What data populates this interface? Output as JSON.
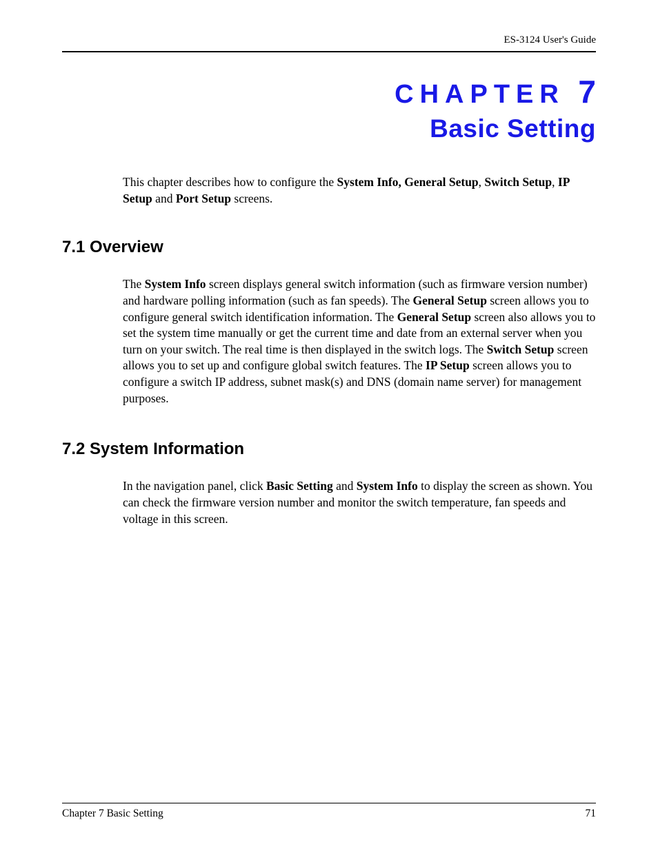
{
  "header": {
    "guide_title": "ES-3124 User's Guide"
  },
  "chapter": {
    "label_word": "CHAPTER",
    "number": "7",
    "title": "Basic Setting"
  },
  "intro": {
    "t1": "This chapter describes how to configure the ",
    "b1": "System Info, General Setup",
    "t2": ", ",
    "b2": "Switch Setup",
    "t3": ", ",
    "b3": "IP Setup",
    "t4": " and ",
    "b4": "Port Setup",
    "t5": " screens."
  },
  "section71": {
    "heading": "7.1  Overview",
    "p": {
      "t1": "The ",
      "b1": "System Info",
      "t2": " screen displays general switch information (such as firmware version number) and hardware polling information (such as fan speeds). The ",
      "b2": "General Setup",
      "t3": " screen allows you to configure general switch identification information. The ",
      "b3": "General Setup",
      "t4": " screen also allows you to set the system time manually or get the current time and date from an external server when you turn on your switch. The real time is then displayed in the switch logs. The ",
      "b4": "Switch Setup",
      "t5": " screen allows you to set up and configure global switch features. The ",
      "b5": "IP Setup",
      "t6": " screen allows you to configure a switch IP address, subnet mask(s) and DNS (domain name server) for management purposes."
    }
  },
  "section72": {
    "heading": "7.2  System Information",
    "p": {
      "t1": "In the navigation panel, click ",
      "b1": "Basic Setting",
      "t2": " and ",
      "b2": "System Info",
      "t3": " to display the screen as shown. You can check the firmware version number and monitor the switch temperature, fan speeds and voltage in this screen."
    }
  },
  "footer": {
    "left": "Chapter 7 Basic Setting",
    "right": "71"
  }
}
